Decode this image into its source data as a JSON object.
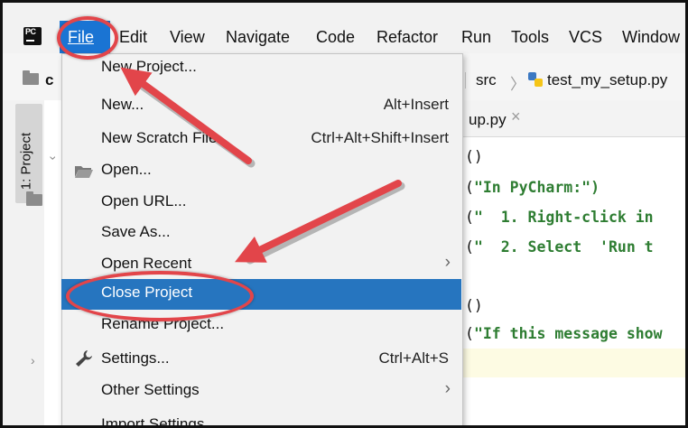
{
  "menubar": {
    "items": [
      "File",
      "Edit",
      "View",
      "Navigate",
      "Code",
      "Refactor",
      "Run",
      "Tools",
      "VCS",
      "Window"
    ]
  },
  "toolbar": {
    "project_initial": "c",
    "breadcrumb_folder": "src",
    "breadcrumb_file": "test_my_setup.py"
  },
  "toolwindow": {
    "project_tab": "1: Project"
  },
  "editor": {
    "tab_label": "up.py",
    "lines": [
      {
        "p": "()",
        "s": ""
      },
      {
        "p": "(",
        "s": "\"In PyCharm:\")"
      },
      {
        "p": "(",
        "s": "\"  1. Right-click in"
      },
      {
        "p": "(",
        "s": "\"  2. Select  'Run t"
      },
      {
        "p": "",
        "s": ""
      },
      {
        "p": "()",
        "s": ""
      },
      {
        "p": "(",
        "s": "\"If this message show"
      }
    ]
  },
  "file_menu": {
    "items": [
      {
        "label": "New Project...",
        "shortcut": "",
        "submenu": false,
        "selected": false
      },
      {
        "label": "New...",
        "shortcut": "Alt+Insert",
        "submenu": false,
        "selected": false
      },
      {
        "label": "New Scratch File",
        "shortcut": "Ctrl+Alt+Shift+Insert",
        "submenu": false,
        "selected": false
      },
      {
        "label": "Open...",
        "shortcut": "",
        "submenu": false,
        "selected": false,
        "icon": "folder-open-icon"
      },
      {
        "label": "Open URL...",
        "shortcut": "",
        "submenu": false,
        "selected": false
      },
      {
        "label": "Save As...",
        "shortcut": "",
        "submenu": false,
        "selected": false
      },
      {
        "label": "Open Recent",
        "shortcut": "",
        "submenu": true,
        "selected": false
      },
      {
        "label": "Close Project",
        "shortcut": "",
        "submenu": false,
        "selected": true
      },
      {
        "label": "Rename Project...",
        "shortcut": "",
        "submenu": false,
        "selected": false
      },
      {
        "label": "Settings...",
        "shortcut": "Ctrl+Alt+S",
        "submenu": false,
        "selected": false,
        "icon": "wrench-icon"
      },
      {
        "label": "Other Settings",
        "shortcut": "",
        "submenu": true,
        "selected": false
      },
      {
        "label": "Import Settings...",
        "shortcut": "",
        "submenu": false,
        "selected": false
      }
    ]
  },
  "colors": {
    "selection": "#2675bf",
    "annotation": "#e2454a",
    "code_string": "#2e7d32"
  }
}
